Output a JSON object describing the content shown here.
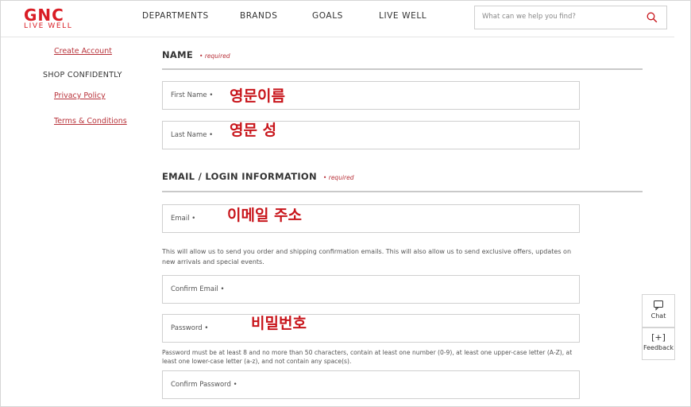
{
  "brand": {
    "name": "GNC",
    "tagline": "LIVE WELL",
    "color": "#d91c24"
  },
  "nav": {
    "items": [
      {
        "label": "DEPARTMENTS"
      },
      {
        "label": "BRANDS"
      },
      {
        "label": "GOALS"
      },
      {
        "label": "LIVE WELL"
      }
    ]
  },
  "search": {
    "placeholder": "What can we help you find?",
    "icon": "search-icon"
  },
  "sidebar": {
    "create_account": "Create Account",
    "heading": "SHOP CONFIDENTLY",
    "links": [
      {
        "label": "Privacy Policy"
      },
      {
        "label": "Terms & Conditions"
      }
    ]
  },
  "form": {
    "name_section": {
      "title": "NAME",
      "required": "• required"
    },
    "first_name": {
      "label": "First Name •",
      "note": "영문이름"
    },
    "last_name": {
      "label": "Last Name •",
      "note": "영문 성"
    },
    "email_section": {
      "title": "EMAIL / LOGIN INFORMATION",
      "required": "• required"
    },
    "email": {
      "label": "Email •",
      "note": "이메일 주소"
    },
    "email_help": "This will allow us to send you order and shipping confirmation emails.   This will also allow us to send exclusive offers, updates on new arrivals and special events.",
    "confirm_email": {
      "label": "Confirm Email •"
    },
    "password": {
      "label": "Password •",
      "note": "비밀번호"
    },
    "password_help": "Password must be at least 8 and no more than 50 characters, contain at least one number (0-9), at least one upper-case letter (A-Z), at least one lower-case letter (a-z), and not contain any space(s).",
    "confirm_password": {
      "label": "Confirm Password •"
    }
  },
  "widgets": {
    "chat": {
      "label": "Chat",
      "icon": "chat-bubble-icon"
    },
    "feedback": {
      "label": "Feedback",
      "icon": "feedback-plus-icon"
    }
  },
  "colors": {
    "accent": "#b8323a",
    "annotation": "#c8151b"
  }
}
